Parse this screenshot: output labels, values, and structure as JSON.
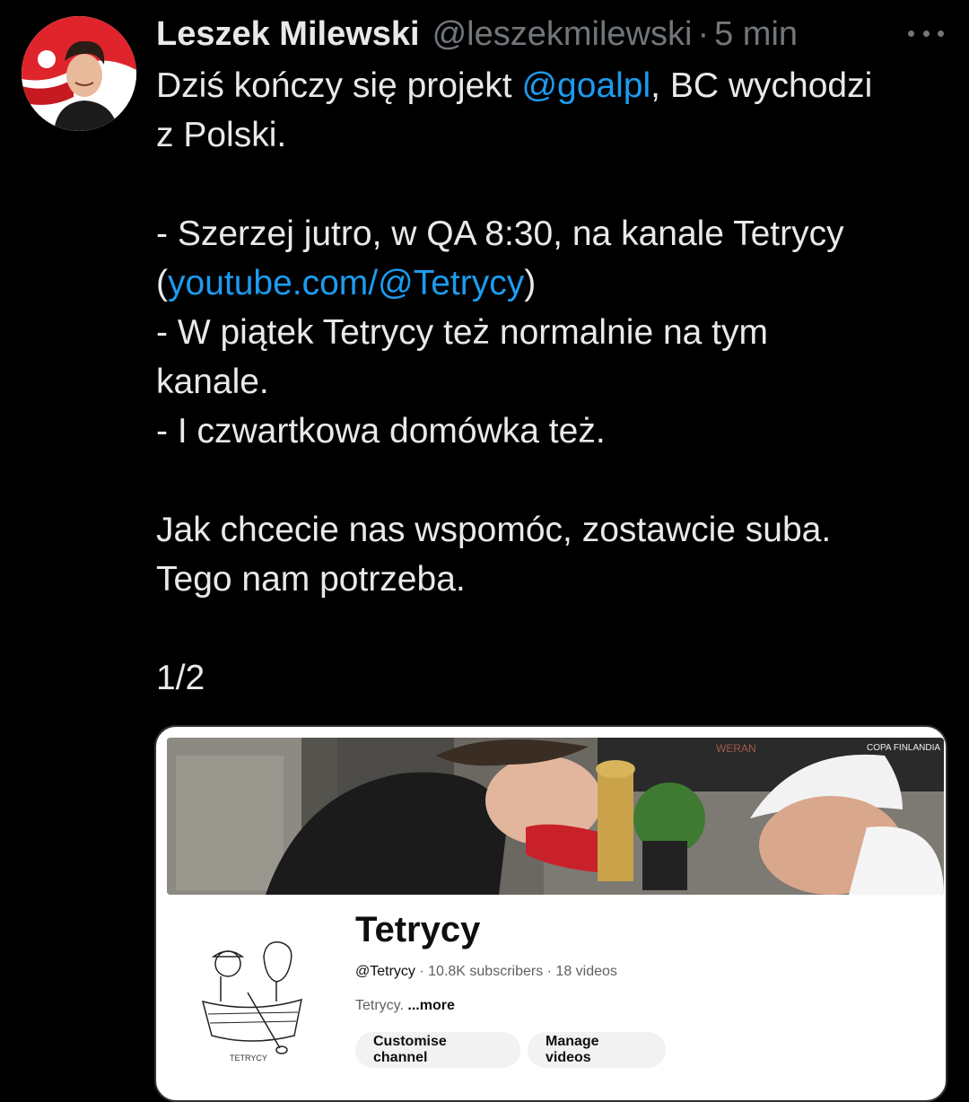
{
  "tweet": {
    "author_name": "Leszek Milewski",
    "author_handle": "@leszekmilewski",
    "separator": "·",
    "time": "5 min",
    "more_menu_icon": "more-dots-icon",
    "lines": {
      "l1_pre": "Dziś kończy się projekt ",
      "l1_mention": "@goalpl",
      "l1_post": ", BC wychodzi",
      "l2": "z Polski.",
      "l3": "- Szerzej jutro, w QA 8:30, na kanale Tetrycy",
      "l4_open": "(",
      "l4_link": "youtube.com/@Tetrycy",
      "l4_close": ")",
      "l5": "- W piątek Tetrycy też normalnie na tym",
      "l6": "kanale.",
      "l7": "- I czwartkowa domówka też.",
      "l8": "Jak chcecie nas wspomóc, zostawcie suba.",
      "l9": "Tego nam potrzeba.",
      "l10": "1/2"
    },
    "colors": {
      "background": "#000000",
      "text": "#e7e9ea",
      "muted": "#71767b",
      "link": "#1d9bf0"
    }
  },
  "card": {
    "banner_sign_1": "WERAN",
    "banner_sign_2": "COPA FINLANDIA",
    "channel_name": "Tetrycy",
    "channel_handle": "@Tetrycy",
    "dot": " · ",
    "subscribers": "10.8K subscribers",
    "videos": "18 videos",
    "description": "Tetrycy. ",
    "more_label": "...more",
    "logo_caption": "TETRYCY",
    "buttons": {
      "customise": "Customise channel",
      "manage": "Manage videos"
    }
  }
}
